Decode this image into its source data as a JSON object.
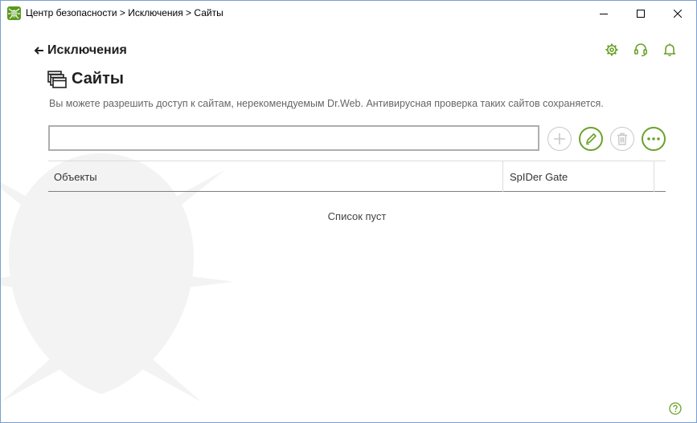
{
  "window": {
    "title": "Центр безопасности > Исключения > Сайты"
  },
  "header": {
    "back_label": "Исключения",
    "page_title": "Сайты",
    "description": "Вы можете разрешить доступ к сайтам, нерекомендуемым Dr.Web. Антивирусная проверка таких сайтов сохраняется."
  },
  "toolbar": {
    "input_value": "",
    "buttons": [
      "add",
      "edit",
      "delete",
      "more"
    ]
  },
  "table": {
    "columns": [
      "Объекты",
      "SpIDer Gate"
    ],
    "empty_text": "Список пуст"
  },
  "icons": {
    "app": "drweb-spider-logo-icon",
    "top_right": [
      "gear-icon",
      "headset-icon",
      "bell-icon"
    ],
    "help": "question-circle-icon"
  },
  "colors": {
    "accent": "#6aa22a",
    "disabled": "#c8c8c8",
    "text_muted": "#666666"
  }
}
